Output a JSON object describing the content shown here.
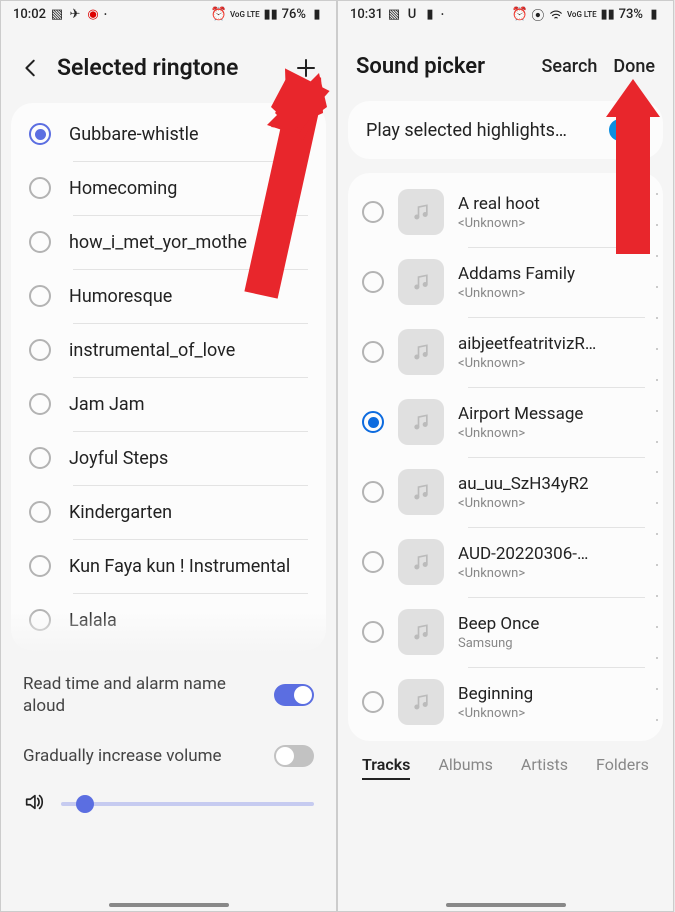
{
  "left": {
    "status": {
      "time": "10:02",
      "battery": "76%",
      "net_label": "VoG LTE"
    },
    "header": {
      "title": "Selected ringtone"
    },
    "ringtones": [
      {
        "label": "Gubbare-whistle",
        "selected": true
      },
      {
        "label": "Homecoming",
        "selected": false
      },
      {
        "label": "how_i_met_yor_mothe",
        "selected": false
      },
      {
        "label": "Humoresque",
        "selected": false
      },
      {
        "label": "instrumental_of_love",
        "selected": false
      },
      {
        "label": "Jam Jam",
        "selected": false
      },
      {
        "label": "Joyful Steps",
        "selected": false
      },
      {
        "label": "Kindergarten",
        "selected": false
      },
      {
        "label": "Kun Faya kun ! Instrumental",
        "selected": false
      },
      {
        "label": "Lalala",
        "selected": false
      }
    ],
    "settings": {
      "read_aloud_label": "Read time and alarm name aloud",
      "read_aloud_on": true,
      "grad_volume_label": "Gradually increase volume",
      "grad_volume_on": false
    }
  },
  "right": {
    "status": {
      "time": "10:31",
      "battery": "73%",
      "net_label": "VoG LTE"
    },
    "header": {
      "title": "Sound picker",
      "search": "Search",
      "done": "Done"
    },
    "highlight_label": "Play selected highlights…",
    "highlight_on": true,
    "songs": [
      {
        "title": "A real hoot",
        "artist": "<Unknown>",
        "selected": false
      },
      {
        "title": "Addams Family",
        "artist": "<Unknown>",
        "selected": false
      },
      {
        "title": "aibjeetfeatritvizR…",
        "artist": "<Unknown>",
        "selected": false
      },
      {
        "title": "Airport Message",
        "artist": "<Unknown>",
        "selected": true
      },
      {
        "title": "au_uu_SzH34yR2",
        "artist": "<Unknown>",
        "selected": false
      },
      {
        "title": "AUD-20220306-…",
        "artist": "<Unknown>",
        "selected": false
      },
      {
        "title": "Beep Once",
        "artist": "Samsung",
        "selected": false
      },
      {
        "title": "Beginning",
        "artist": "<Unknown>",
        "selected": false
      }
    ],
    "tabs": {
      "tracks": "Tracks",
      "albums": "Albums",
      "artists": "Artists",
      "folders": "Folders",
      "active": "tracks"
    }
  }
}
